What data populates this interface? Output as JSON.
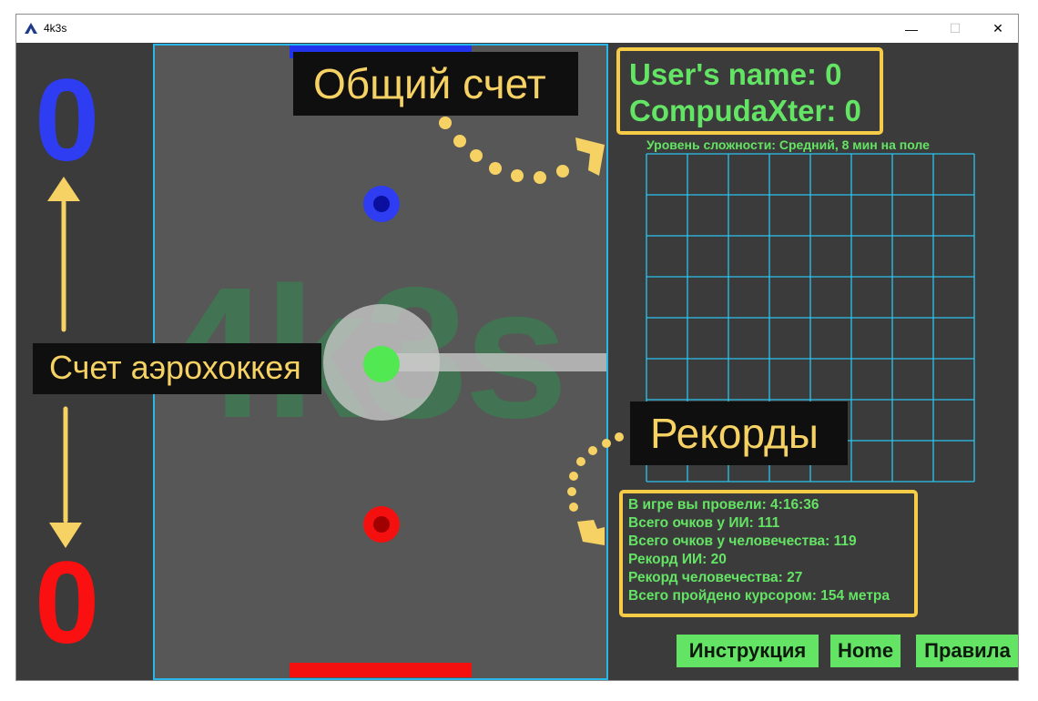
{
  "window": {
    "title": "4k3s",
    "controls": {
      "minimize": "—",
      "maximize": "☐",
      "close": "✕"
    }
  },
  "scores": {
    "ai": "0",
    "user": "0"
  },
  "rink": {
    "watermark": "4k3s"
  },
  "callouts": {
    "total_score": "Общий счет",
    "hockey_score": "Счет аэрохоккея",
    "records": "Рекорды"
  },
  "scoreboard": {
    "user_line": "User's name: 0",
    "ai_line": "CompudaXter: 0"
  },
  "level_text": "Уровень сложности: Средний, 8 мин на поле",
  "grid": {
    "cols": 8,
    "rows": 8
  },
  "stats": [
    "В игре вы провели: 4:16:36",
    "Всего очков у ИИ: 111",
    "Всего очков у человечества: 119",
    "Рекорд ИИ: 20",
    "Рекорд человечества: 27",
    "Всего пройдено курсором: 154 метра"
  ],
  "buttons": {
    "instructions": "Инструкция",
    "home": "Home",
    "rules": "Правила"
  },
  "colors": {
    "accent_green": "#64e464",
    "callout_yellow": "#f6d163",
    "ai_blue": "#2e3cf2",
    "user_red": "#fa1010",
    "rink_border": "#29b6e8"
  }
}
